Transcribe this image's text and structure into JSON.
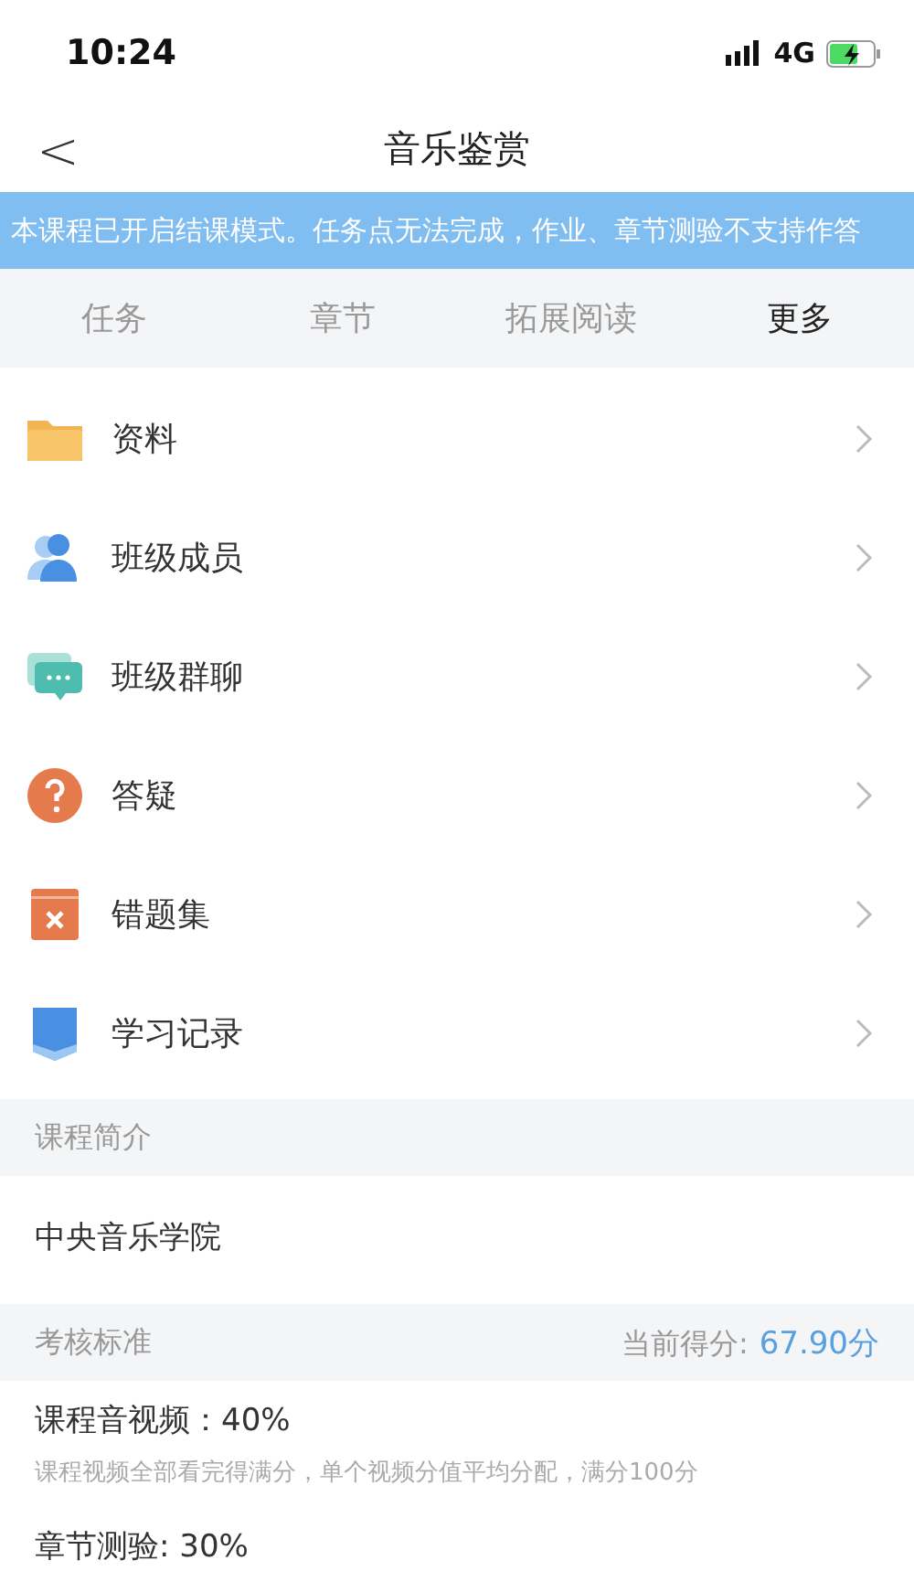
{
  "status_bar": {
    "time": "10:24",
    "network": "4G"
  },
  "nav": {
    "back": "<",
    "title": "音乐鉴赏"
  },
  "notice": "本课程已开启结课模式。任务点无法完成，作业、章节测验不支持作答",
  "tabs": [
    {
      "label": "任务",
      "selected": false
    },
    {
      "label": "章节",
      "selected": false
    },
    {
      "label": "拓展阅读",
      "selected": false
    },
    {
      "label": "更多",
      "selected": true
    }
  ],
  "menu": [
    {
      "kind": "folder",
      "label": "资料"
    },
    {
      "kind": "members",
      "label": "班级成员"
    },
    {
      "kind": "chat",
      "label": "班级群聊"
    },
    {
      "kind": "question",
      "label": "答疑"
    },
    {
      "kind": "mistakes",
      "label": "错题集"
    },
    {
      "kind": "record",
      "label": "学习记录"
    }
  ],
  "intro": {
    "header": "课程简介",
    "text": "中央音乐学院"
  },
  "assessment": {
    "header": "考核标准",
    "score_label": "当前得分:",
    "score": "67.90分",
    "items": [
      {
        "title": "课程音视频：40%",
        "note": "课程视频全部看完得满分，单个视频分值平均分配，满分100分"
      },
      {
        "title": "章节测验: 30%"
      }
    ]
  }
}
